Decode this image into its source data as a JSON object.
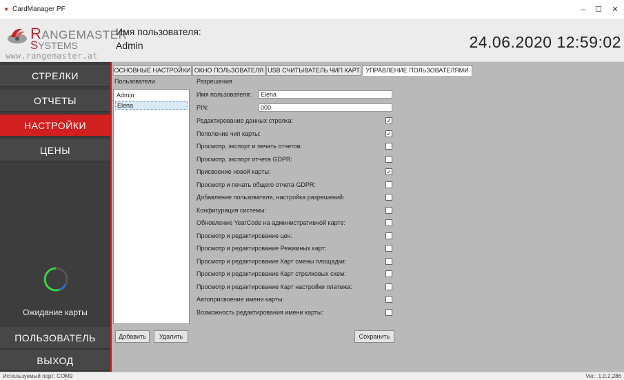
{
  "window": {
    "title": "CardManager PF",
    "minimize": "–",
    "maximize": "☐",
    "close": "✕"
  },
  "logo": {
    "line1_cap": "R",
    "line1_rest": "ANGEMASTER",
    "line2_cap": "S",
    "line2_rest": "YSTEMS",
    "url": "www.rangemaster.at",
    "brand_color": "#c0262d"
  },
  "header": {
    "user_label": "Имя пользователя:",
    "user_value": "Admin",
    "datetime": "24.06.2020  12:59:02"
  },
  "sidebar": {
    "items": [
      {
        "label": "СТРЕЛКИ",
        "active": false
      },
      {
        "label": "ОТЧЕТЫ",
        "active": false
      },
      {
        "label": "НАСТРОЙКИ",
        "active": true
      },
      {
        "label": "ЦЕНЫ",
        "active": false
      }
    ],
    "waiting_text": "Ожидание карты",
    "user_button": "ПОЛЬЗОВАТЕЛЬ",
    "exit_button": "ВЫХОД",
    "accent_color": "#d21f1f"
  },
  "tabs": [
    {
      "label": "ОСНОВНЫЕ НАСТРОЙКИ",
      "active": false
    },
    {
      "label": "ОКНО ПОЛЬЗОВАТЕЛЯ",
      "active": false
    },
    {
      "label": "USB СЧИТЫВАТЕЛЬ ЧИП КАРТ",
      "active": false
    },
    {
      "label": "УПРАВЛЕНИЕ ПОЛЬЗОВАТЕЛЯМИ",
      "active": true
    }
  ],
  "users_panel": {
    "title": "Пользователи",
    "users": [
      {
        "name": "Admin",
        "selected": false
      },
      {
        "name": "Elena",
        "selected": true
      }
    ],
    "add_button": "Добавить",
    "delete_button": "Удалить"
  },
  "permissions_panel": {
    "title": "Разрешения",
    "username_label": "Имя пользователя:",
    "username_value": "Elena",
    "pin_label": "PIN:",
    "pin_value": "000",
    "save_button": "Сохранить",
    "items": [
      {
        "label": "Редактирование данных стрелка:",
        "checked": true
      },
      {
        "label": "Пополение чип карты:",
        "checked": true
      },
      {
        "label": "Просмотр, экспорт и печать отчетов:",
        "checked": false
      },
      {
        "label": "Просмотр, экспорт отчета GDPR:",
        "checked": false
      },
      {
        "label": "Присвоение новой карты:",
        "checked": true
      },
      {
        "label": "Просмотр и печать общего отчета GDPR:",
        "checked": false
      },
      {
        "label": "Добавление пользователя, настройка разрешений:",
        "checked": false
      },
      {
        "label": "Конфигурация системы:",
        "checked": false
      },
      {
        "label": "Обновление YearCode на административной карте:",
        "checked": false
      },
      {
        "label": "Просмотр и редактирование цен:",
        "checked": false
      },
      {
        "label": "Просмотр и редактирование Режимных карт:",
        "checked": false
      },
      {
        "label": "Просмотр и редактирование Карт смены площадки:",
        "checked": false
      },
      {
        "label": "Просмотр и редактирование Карт стрелковых схем:",
        "checked": false
      },
      {
        "label": "Просмотр и редактирование Карт настройки платежа:",
        "checked": false
      },
      {
        "label": "Автоприсвоение имени карты:",
        "checked": false
      },
      {
        "label": "Возможность редактирования имени карты:",
        "checked": false
      }
    ]
  },
  "statusbar": {
    "port": "Используемый порт: COM9",
    "version": "Ver.: 1.0.2.286"
  }
}
